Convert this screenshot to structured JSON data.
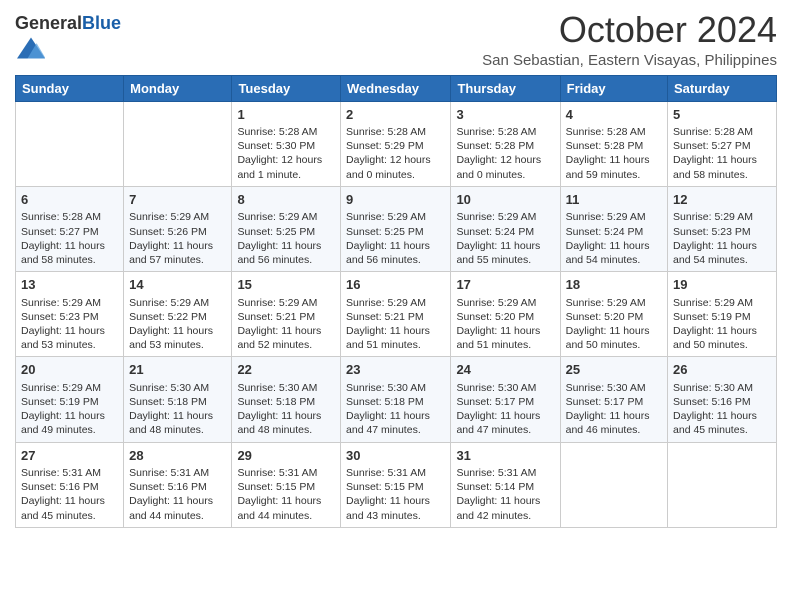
{
  "header": {
    "logo_general": "General",
    "logo_blue": "Blue",
    "month_title": "October 2024",
    "location": "San Sebastian, Eastern Visayas, Philippines"
  },
  "days_of_week": [
    "Sunday",
    "Monday",
    "Tuesday",
    "Wednesday",
    "Thursday",
    "Friday",
    "Saturday"
  ],
  "weeks": [
    [
      {
        "day": "",
        "info": ""
      },
      {
        "day": "",
        "info": ""
      },
      {
        "day": "1",
        "info": "Sunrise: 5:28 AM\nSunset: 5:30 PM\nDaylight: 12 hours and 1 minute."
      },
      {
        "day": "2",
        "info": "Sunrise: 5:28 AM\nSunset: 5:29 PM\nDaylight: 12 hours and 0 minutes."
      },
      {
        "day": "3",
        "info": "Sunrise: 5:28 AM\nSunset: 5:28 PM\nDaylight: 12 hours and 0 minutes."
      },
      {
        "day": "4",
        "info": "Sunrise: 5:28 AM\nSunset: 5:28 PM\nDaylight: 11 hours and 59 minutes."
      },
      {
        "day": "5",
        "info": "Sunrise: 5:28 AM\nSunset: 5:27 PM\nDaylight: 11 hours and 58 minutes."
      }
    ],
    [
      {
        "day": "6",
        "info": "Sunrise: 5:28 AM\nSunset: 5:27 PM\nDaylight: 11 hours and 58 minutes."
      },
      {
        "day": "7",
        "info": "Sunrise: 5:29 AM\nSunset: 5:26 PM\nDaylight: 11 hours and 57 minutes."
      },
      {
        "day": "8",
        "info": "Sunrise: 5:29 AM\nSunset: 5:25 PM\nDaylight: 11 hours and 56 minutes."
      },
      {
        "day": "9",
        "info": "Sunrise: 5:29 AM\nSunset: 5:25 PM\nDaylight: 11 hours and 56 minutes."
      },
      {
        "day": "10",
        "info": "Sunrise: 5:29 AM\nSunset: 5:24 PM\nDaylight: 11 hours and 55 minutes."
      },
      {
        "day": "11",
        "info": "Sunrise: 5:29 AM\nSunset: 5:24 PM\nDaylight: 11 hours and 54 minutes."
      },
      {
        "day": "12",
        "info": "Sunrise: 5:29 AM\nSunset: 5:23 PM\nDaylight: 11 hours and 54 minutes."
      }
    ],
    [
      {
        "day": "13",
        "info": "Sunrise: 5:29 AM\nSunset: 5:23 PM\nDaylight: 11 hours and 53 minutes."
      },
      {
        "day": "14",
        "info": "Sunrise: 5:29 AM\nSunset: 5:22 PM\nDaylight: 11 hours and 53 minutes."
      },
      {
        "day": "15",
        "info": "Sunrise: 5:29 AM\nSunset: 5:21 PM\nDaylight: 11 hours and 52 minutes."
      },
      {
        "day": "16",
        "info": "Sunrise: 5:29 AM\nSunset: 5:21 PM\nDaylight: 11 hours and 51 minutes."
      },
      {
        "day": "17",
        "info": "Sunrise: 5:29 AM\nSunset: 5:20 PM\nDaylight: 11 hours and 51 minutes."
      },
      {
        "day": "18",
        "info": "Sunrise: 5:29 AM\nSunset: 5:20 PM\nDaylight: 11 hours and 50 minutes."
      },
      {
        "day": "19",
        "info": "Sunrise: 5:29 AM\nSunset: 5:19 PM\nDaylight: 11 hours and 50 minutes."
      }
    ],
    [
      {
        "day": "20",
        "info": "Sunrise: 5:29 AM\nSunset: 5:19 PM\nDaylight: 11 hours and 49 minutes."
      },
      {
        "day": "21",
        "info": "Sunrise: 5:30 AM\nSunset: 5:18 PM\nDaylight: 11 hours and 48 minutes."
      },
      {
        "day": "22",
        "info": "Sunrise: 5:30 AM\nSunset: 5:18 PM\nDaylight: 11 hours and 48 minutes."
      },
      {
        "day": "23",
        "info": "Sunrise: 5:30 AM\nSunset: 5:18 PM\nDaylight: 11 hours and 47 minutes."
      },
      {
        "day": "24",
        "info": "Sunrise: 5:30 AM\nSunset: 5:17 PM\nDaylight: 11 hours and 47 minutes."
      },
      {
        "day": "25",
        "info": "Sunrise: 5:30 AM\nSunset: 5:17 PM\nDaylight: 11 hours and 46 minutes."
      },
      {
        "day": "26",
        "info": "Sunrise: 5:30 AM\nSunset: 5:16 PM\nDaylight: 11 hours and 45 minutes."
      }
    ],
    [
      {
        "day": "27",
        "info": "Sunrise: 5:31 AM\nSunset: 5:16 PM\nDaylight: 11 hours and 45 minutes."
      },
      {
        "day": "28",
        "info": "Sunrise: 5:31 AM\nSunset: 5:16 PM\nDaylight: 11 hours and 44 minutes."
      },
      {
        "day": "29",
        "info": "Sunrise: 5:31 AM\nSunset: 5:15 PM\nDaylight: 11 hours and 44 minutes."
      },
      {
        "day": "30",
        "info": "Sunrise: 5:31 AM\nSunset: 5:15 PM\nDaylight: 11 hours and 43 minutes."
      },
      {
        "day": "31",
        "info": "Sunrise: 5:31 AM\nSunset: 5:14 PM\nDaylight: 11 hours and 42 minutes."
      },
      {
        "day": "",
        "info": ""
      },
      {
        "day": "",
        "info": ""
      }
    ]
  ]
}
